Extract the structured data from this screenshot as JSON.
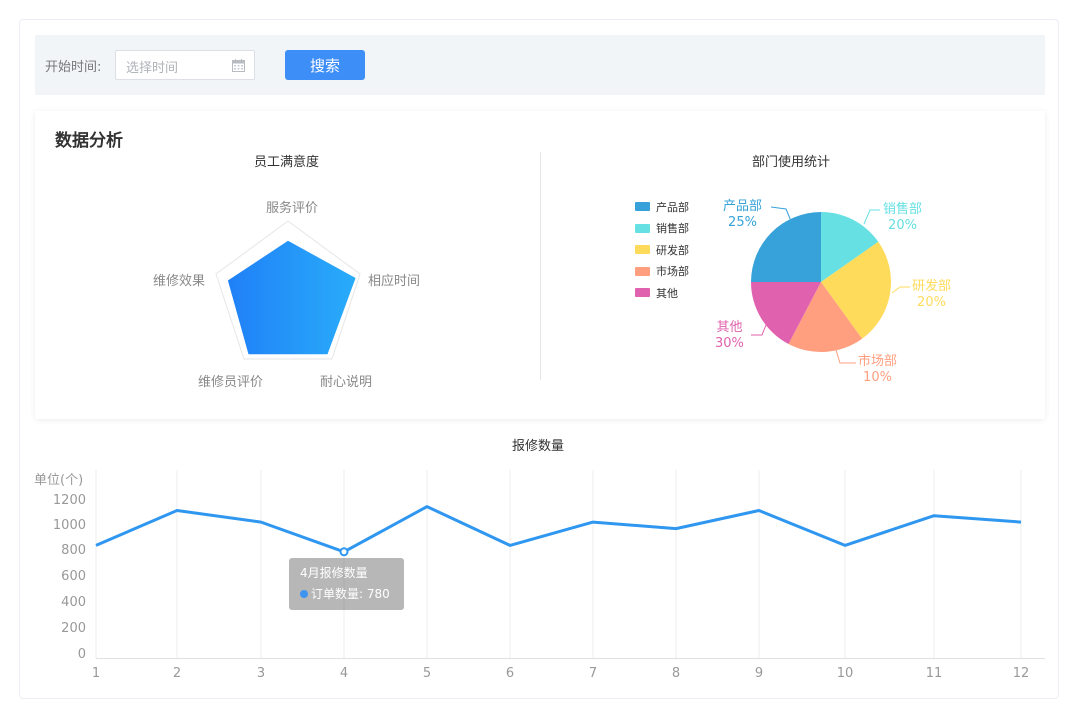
{
  "filter": {
    "label": "开始时间:",
    "date_placeholder": "选择时间",
    "search_label": "搜索"
  },
  "analysis": {
    "title": "数据分析",
    "radar_title": "员工满意度",
    "pie_title": "部门使用统计"
  },
  "radar": {
    "indicators": [
      "服务评价",
      "相应时间",
      "耐心说明",
      "维修员评价",
      "维修效果"
    ],
    "values": [
      0.75,
      0.9,
      0.85,
      0.85,
      0.8
    ]
  },
  "pie": {
    "legend": [
      "产品部",
      "销售部",
      "研发部",
      "市场部",
      "其他"
    ],
    "colors": [
      "#37a2da",
      "#67e0e3",
      "#ffdb5c",
      "#ff9f7f",
      "#e062ae"
    ],
    "slices": [
      {
        "name": "产品部",
        "pct": "25%"
      },
      {
        "name": "销售部",
        "pct": "20%"
      },
      {
        "name": "研发部",
        "pct": "20%"
      },
      {
        "name": "市场部",
        "pct": "10%"
      },
      {
        "name": "其他",
        "pct": "30%"
      }
    ]
  },
  "line": {
    "title": "报修数量",
    "unit_label": "单位(个)",
    "y_ticks": [
      "1200",
      "1000",
      "800",
      "600",
      "400",
      "200",
      "0"
    ],
    "x_labels": [
      "1",
      "2",
      "3",
      "4",
      "5",
      "6",
      "7",
      "8",
      "9",
      "10",
      "11",
      "12"
    ],
    "color": "#2f97f0"
  },
  "tooltip": {
    "title": "4月报修数量",
    "series_label": "订单数量: 780"
  },
  "chart_data": {
    "type": "line",
    "title": "报修数量",
    "ylabel": "单位(个)",
    "categories": [
      "1",
      "2",
      "3",
      "4",
      "5",
      "6",
      "7",
      "8",
      "9",
      "10",
      "11",
      "12"
    ],
    "values": [
      850,
      1120,
      1030,
      800,
      1150,
      850,
      1030,
      980,
      1120,
      850,
      1080,
      1030
    ],
    "ylim": [
      0,
      1300
    ],
    "grid": "vertical"
  }
}
